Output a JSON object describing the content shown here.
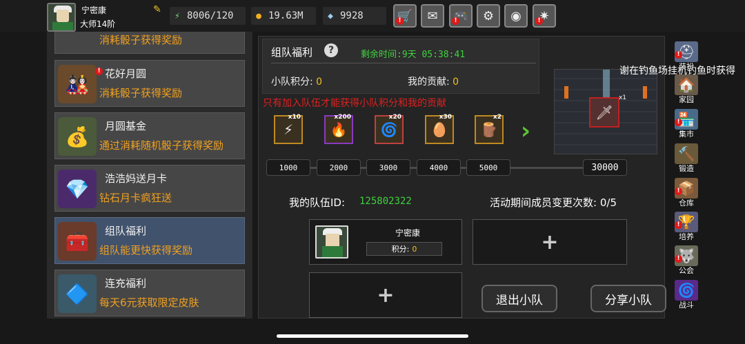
{
  "player": {
    "name": "宁密康",
    "rank": "大师14阶"
  },
  "resources": {
    "energy": "8006/120",
    "gold": "19.63M",
    "gems": "9928"
  },
  "top_buttons": [
    {
      "icon": "shop-cart-icon",
      "glyph": "🛒",
      "badge": "!"
    },
    {
      "icon": "mail-icon",
      "glyph": "✉",
      "badge": ""
    },
    {
      "icon": "gamepad-icon",
      "glyph": "🎮",
      "badge": "!"
    },
    {
      "icon": "settings-gear-icon",
      "glyph": "⚙",
      "badge": ""
    },
    {
      "icon": "aperture-icon",
      "glyph": "◉",
      "badge": ""
    },
    {
      "icon": "firework-icon",
      "glyph": "✷",
      "badge": "!"
    }
  ],
  "left_list": {
    "partial_item": {
      "subtitle": "消耗骰子获得奖励"
    },
    "items": [
      {
        "title": "花好月圆",
        "subtitle": "消耗骰子获得奖励",
        "badge": "!",
        "icon": "mooncake-girl-icon",
        "glyph": "🎎"
      },
      {
        "title": "月圆基金",
        "subtitle": "通过消耗随机骰子获得奖励",
        "badge": "",
        "icon": "money-bag-icon",
        "glyph": "💰"
      },
      {
        "title": "浩浩妈送月卡",
        "subtitle": "钻石月卡疯狂送",
        "badge": "",
        "icon": "diamond-card-icon",
        "glyph": "💎"
      },
      {
        "title": "组队福利",
        "subtitle": "组队能更快获得奖励",
        "badge": "",
        "icon": "treasure-chest-icon",
        "glyph": "🧰",
        "active": true
      },
      {
        "title": "连充福利",
        "subtitle": "每天6元获取限定皮肤",
        "badge": "",
        "icon": "crystal-cluster-icon",
        "glyph": "🔷"
      }
    ]
  },
  "team": {
    "title": "组队福利",
    "remaining_label": "剩余时间:",
    "remaining_value": "9天 05:38:41",
    "score_label": "小队积分:",
    "score_value": "0",
    "contrib_label": "我的贡献:",
    "contrib_value": "0",
    "warning": "只有加入队伍才能获得小队积分和我的贡献",
    "rewards": [
      {
        "count": "x10",
        "icon": "lightning-scroll-icon",
        "glyph": "⚡",
        "border": "#c08a20"
      },
      {
        "count": "x200",
        "icon": "fire-orb-icon",
        "glyph": "🔥",
        "border": "#8a3ac0"
      },
      {
        "count": "x20",
        "icon": "blue-rune-icon",
        "glyph": "🌀",
        "border": "#c04040"
      },
      {
        "count": "x30",
        "icon": "golden-egg-icon",
        "glyph": "🥚",
        "border": "#c08a20"
      },
      {
        "count": "x2",
        "icon": "cannon-icon",
        "glyph": "🪵",
        "border": "#c08a20"
      }
    ],
    "milestones": [
      "1000",
      "2000",
      "3000",
      "4000",
      "5000",
      "30000"
    ],
    "preview_count": "x1",
    "team_id_label": "我的队伍ID:",
    "team_id_value": "125802322",
    "changes_label": "活动期间成员变更次数:",
    "changes_value": "0/5",
    "member": {
      "name": "宁密康",
      "score_label": "积分:",
      "score_value": "0"
    },
    "empty_slot": "+",
    "quit_button": "退出小队",
    "share_button": "分享小队"
  },
  "right_nav": [
    {
      "label": "装扮",
      "icon": "helmet-icon",
      "glyph": "⛑",
      "badge": "!"
    },
    {
      "label": "家园",
      "icon": "house-icon",
      "glyph": "🏠",
      "badge": ""
    },
    {
      "label": "集市",
      "icon": "market-icon",
      "glyph": "🏪",
      "badge": "!"
    },
    {
      "label": "锻造",
      "icon": "anvil-icon",
      "glyph": "🔨",
      "badge": ""
    },
    {
      "label": "仓库",
      "icon": "warehouse-icon",
      "glyph": "📦",
      "badge": "!"
    },
    {
      "label": "培养",
      "icon": "training-icon",
      "glyph": "🏆",
      "badge": "!"
    },
    {
      "label": "公会",
      "icon": "guild-icon",
      "glyph": "🐺",
      "badge": "!"
    },
    {
      "label": "战斗",
      "icon": "portal-icon",
      "glyph": "🌀",
      "badge": ""
    }
  ],
  "ticker": "谢在钓鱼场挂机钓鱼时获得"
}
